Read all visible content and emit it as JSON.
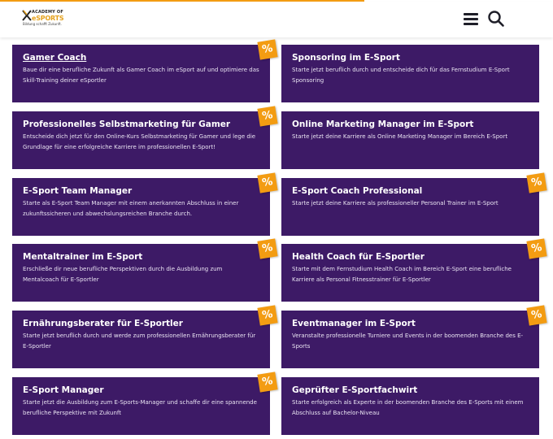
{
  "brand": {
    "logo_line1": "ACADEMY OF",
    "logo_line2": "eSPORTS",
    "tagline": "Bildung schafft Zukunft.",
    "accent": "#f39c12",
    "card_color": "#3d1a66"
  },
  "header": {
    "menu_icon": "hamburger-menu-icon",
    "search_icon": "search-icon"
  },
  "badge_label": "%",
  "cards": [
    {
      "title": "Gamer Coach",
      "desc": "Baue dir eine berufliche Zukunft als Gamer Coach im eSport auf und optimiere das Skill-Training deiner eSportler",
      "badge": true
    },
    {
      "title": "Sponsoring im E-Sport",
      "desc": "Starte jetzt beruflich durch und entscheide dich für das Fernstudium E-Sport Sponsoring",
      "badge": false
    },
    {
      "title": "Professionelles Selbstmarketing für Gamer",
      "desc": "Entscheide dich jetzt für den Online-Kurs Selbstmarketing für Gamer und lege die Grundlage für eine erfolgreiche Karriere im professionellen E-Sport!",
      "badge": true
    },
    {
      "title": "Online Marketing Manager im E-Sport",
      "desc": "Starte jetzt deine Karriere als Online Marketing Manager im Bereich E-Sport",
      "badge": false
    },
    {
      "title": "E-Sport Team Manager",
      "desc": "Starte als E-Sport Team Manager mit einem anerkannten Abschluss in einer zukunftssicheren und abwechslungsreichen Branche durch.",
      "badge": true
    },
    {
      "title": "E-Sport Coach Professional",
      "desc": "Starte jetzt deine Karriere als professioneller Personal Trainer im E-Sport",
      "badge": true
    },
    {
      "title": "Mentaltrainer im E-Sport",
      "desc": "Erschließe dir neue berufliche Perspektiven durch die Ausbildung zum Mentalcoach für E-Sportler",
      "badge": true
    },
    {
      "title": "Health Coach für E-Sportler",
      "desc": "Starte mit dem Fernstudium Health Coach im Bereich E-Sport eine berufliche Karriere als Personal Fitnesstrainer für E-Sportler",
      "badge": true
    },
    {
      "title": "Ernährungsberater für E-Sportler",
      "desc": "Starte jetzt beruflich durch und werde zum professionellen Ernährungsberater für E-Sportler",
      "badge": true
    },
    {
      "title": "Eventmanager im E-Sport",
      "desc": "Veranstalte professionelle Turniere und Events in der boomenden Branche des E-Sports",
      "badge": true
    },
    {
      "title": "E-Sport Manager",
      "desc": "Starte jetzt die Ausbildung zum E-Sports-Manager und schaffe dir eine spannende berufliche Perspektive mit Zukunft",
      "badge": true
    },
    {
      "title": "Geprüfter E-Sportfachwirt",
      "desc": "Starte erfolgreich als Experte in der boomenden Branche des E-Sports mit einem Abschluss auf Bachelor-Niveau",
      "badge": false
    }
  ]
}
